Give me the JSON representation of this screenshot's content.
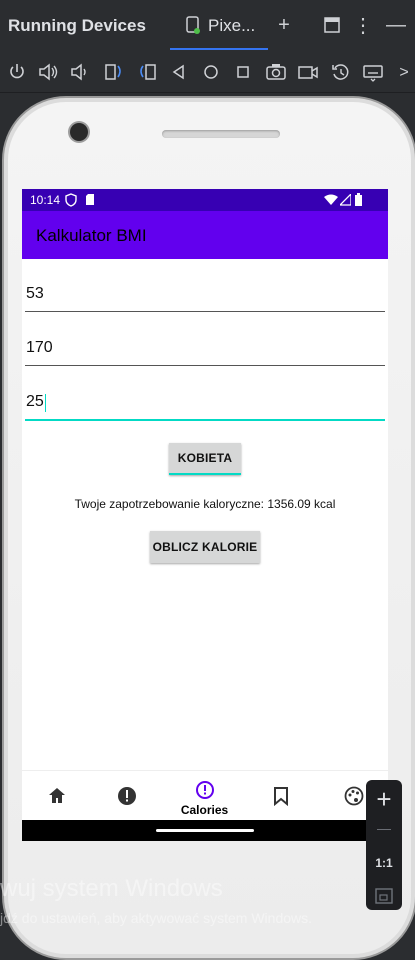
{
  "ide": {
    "panel_title": "Running Devices",
    "tab_label": "Pixe...",
    "add_tab_symbol": "+",
    "more_symbol": "⋮",
    "minimize_symbol": "—",
    "chevron_symbol": ">"
  },
  "device": {
    "status_time": "10:14",
    "app_title": "Kalkulator BMI",
    "fields": [
      "53",
      "170",
      "25"
    ],
    "gender_button": "KOBIETA",
    "result_text": "Twoje zapotrzebowanie kaloryczne: 1356.09 kcal",
    "calc_button": "OBLICZ KALORIE",
    "bottom_nav": {
      "selected_label": "Calories",
      "items": [
        "home-icon",
        "info-icon",
        "calories-icon",
        "bookmark-icon",
        "palette-icon"
      ]
    }
  },
  "zoom_panel": {
    "zoom_in": "+",
    "zoom_out": "—",
    "actual_size": "1:1"
  },
  "watermark": {
    "line1": "wuj system Windows",
    "line2": "jdź do ustawień, aby aktywować system Windows."
  },
  "colors": {
    "status_bar": "#3700b3",
    "app_bar": "#6200ee",
    "focus_line": "#03dac5",
    "nav_selected": "#6200ee"
  }
}
